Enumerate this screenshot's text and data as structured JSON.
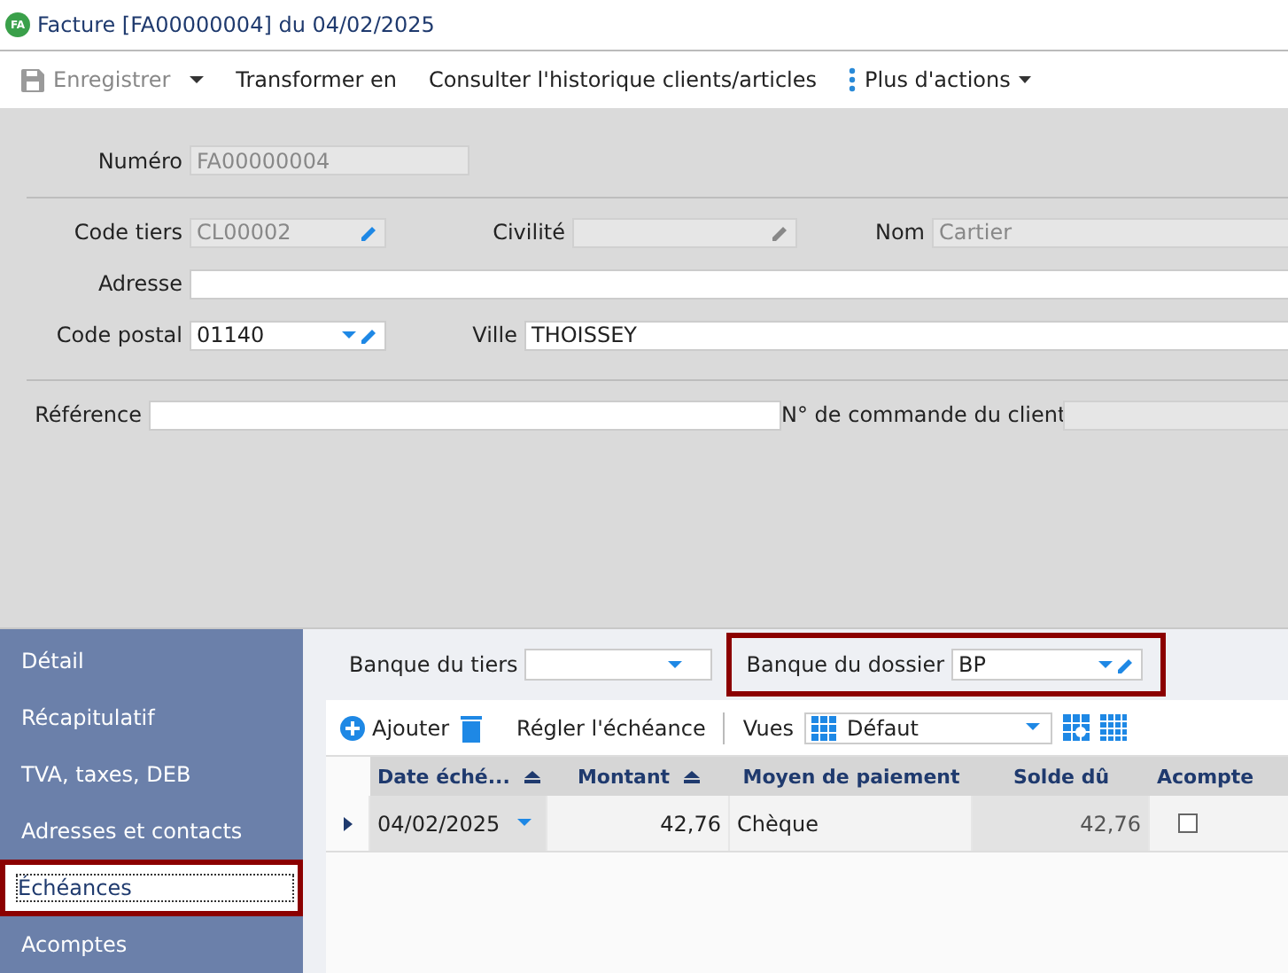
{
  "window": {
    "title": "Facture [FA00000004] du 04/02/2025",
    "badge": "FA"
  },
  "toolbar": [
    {
      "kind": "save",
      "label": "Enregistrer",
      "disabled": true
    },
    {
      "kind": "plain",
      "label": "Transformer en",
      "disabled": false
    },
    {
      "kind": "plain",
      "label": "Consulter l'historique clients/articles",
      "disabled": false
    },
    {
      "kind": "more",
      "label": "Plus d'actions",
      "disabled": false
    }
  ],
  "form": {
    "numero": {
      "label": "Numéro",
      "value": "FA00000004"
    },
    "code_tiers": {
      "label": "Code tiers",
      "value": "CL00002"
    },
    "civilite": {
      "label": "Civilité"
    },
    "nom": {
      "label": "Nom",
      "value": "Cartier"
    },
    "adresse": {
      "label": "Adresse"
    },
    "code_postal": {
      "label": "Code postal",
      "value": "01140"
    },
    "ville": {
      "label": "Ville",
      "value": "THOISSEY"
    },
    "reference": {
      "label": "Référence"
    },
    "commande": {
      "label": "N° de commande du client"
    }
  },
  "sidebar": {
    "items": [
      {
        "label": "Détail",
        "selected": false,
        "highlighted": false
      },
      {
        "label": "Récapitulatif",
        "selected": false,
        "highlighted": false
      },
      {
        "label": "TVA, taxes, DEB",
        "selected": false,
        "highlighted": false
      },
      {
        "label": "Adresses et contacts",
        "selected": false,
        "highlighted": false
      },
      {
        "label": "Échéances",
        "selected": true,
        "highlighted": true
      },
      {
        "label": "Acomptes",
        "selected": false,
        "highlighted": false
      }
    ]
  },
  "banks": {
    "tiers": {
      "label": "Banque du tiers",
      "highlighted": false
    },
    "dossier": {
      "label": "Banque du dossier",
      "value": "BP",
      "highlighted": true
    }
  },
  "grid_toolbar": {
    "add": "Ajouter",
    "settle": "Régler l'échéance",
    "views_label": "Vues",
    "view": "Défaut"
  },
  "table": {
    "columns": [
      {
        "label": "Date éché...",
        "sortable": true
      },
      {
        "label": "Montant",
        "sortable": true
      },
      {
        "label": "Moyen de paiement",
        "sortable": false
      },
      {
        "label": "Solde dû",
        "sortable": false
      },
      {
        "label": "Acompte",
        "sortable": false
      }
    ],
    "rows": [
      {
        "date": "04/02/2025",
        "montant": "42,76",
        "moyen": "Chèque",
        "solde": "42,76",
        "acompte": false
      }
    ]
  }
}
